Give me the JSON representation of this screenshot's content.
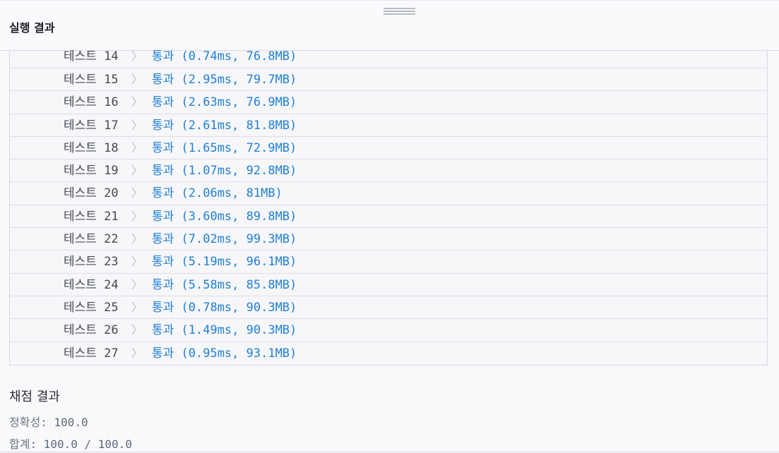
{
  "panel": {
    "title": "실행 결과"
  },
  "tests": [
    {
      "label": "테스트 14",
      "result": "통과 (0.74ms, 76.8MB)"
    },
    {
      "label": "테스트 15",
      "result": "통과 (2.95ms, 79.7MB)"
    },
    {
      "label": "테스트 16",
      "result": "통과 (2.63ms, 76.9MB)"
    },
    {
      "label": "테스트 17",
      "result": "통과 (2.61ms, 81.8MB)"
    },
    {
      "label": "테스트 18",
      "result": "통과 (1.65ms, 72.9MB)"
    },
    {
      "label": "테스트 19",
      "result": "통과 (1.07ms, 92.8MB)"
    },
    {
      "label": "테스트 20",
      "result": "통과 (2.06ms, 81MB)"
    },
    {
      "label": "테스트 21",
      "result": "통과 (3.60ms, 89.8MB)"
    },
    {
      "label": "테스트 22",
      "result": "통과 (7.02ms, 99.3MB)"
    },
    {
      "label": "테스트 23",
      "result": "통과 (5.19ms, 96.1MB)"
    },
    {
      "label": "테스트 24",
      "result": "통과 (5.58ms, 85.8MB)"
    },
    {
      "label": "테스트 25",
      "result": "통과 (0.78ms, 90.3MB)"
    },
    {
      "label": "테스트 26",
      "result": "통과 (1.49ms, 90.3MB)"
    },
    {
      "label": "테스트 27",
      "result": "통과 (0.95ms, 93.1MB)"
    }
  ],
  "scoring": {
    "title": "채점 결과",
    "accuracy_label": "정확성:",
    "accuracy_value": "100.0",
    "total_label": "합계:",
    "total_value": "100.0 / 100.0"
  },
  "icons": {
    "chevron": "chevron-right-icon",
    "handle": "drag-handle-icon"
  },
  "colors": {
    "pass_text": "#1f7fd6",
    "label_text": "#454955"
  }
}
